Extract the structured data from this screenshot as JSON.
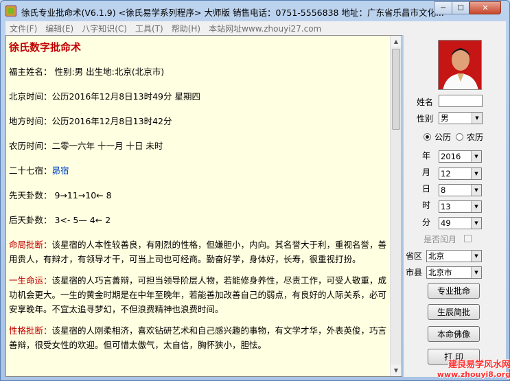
{
  "window": {
    "title": "徐氏专业批命术(V6.1.9) <徐氏易学系列程序> 大师版  销售电话：0751-5556838  地址：广东省乐昌市文化...",
    "controls": [
      "─",
      "☐",
      "✕"
    ]
  },
  "menu": [
    "文件(F)",
    "编辑(E)",
    "八字知识(C)",
    "工具(T)",
    "帮助(H)",
    "本站网址www.zhouyi27.com"
  ],
  "doc": {
    "title": "徐氏数字批命术",
    "lines": [
      "福主姓名：  性别:男   出生地:北京(北京市)",
      "北京时间：公历2016年12月8日13时49分 星期四",
      "地方时间：公历2016年12月8日13时42分",
      "农历时间：二零一六年 十一月 十日 未时"
    ],
    "xiu_label": "二十七宿：",
    "xiu_value": "昴宿",
    "xiantian": "先天卦数： 9→11→10← 8",
    "houtian": "后天卦数： 3<- 5— 4← 2",
    "paras": [
      {
        "label": "命局批断：",
        "text": "该星宿的人本性较善良，有刚烈的性格，但嫌胆小，内向。其名誉大于利，重视名誉，善用贵人，有辩才，有领导才干，可当上司也可经商。勤奋好学，身体好，长寿，很重视打扮。"
      },
      {
        "label": "一生命运：",
        "text": "该星宿的人巧言善辩，可担当领导阶层人物，若能修身养性，尽责工作，可受人敬重，成功机会更大。一生的黄金时期是在中年至晚年，若能善加改善自己的弱点，有良好的人际关系，必可安享晚年。不宜太追寻梦幻，不但浪费精神也浪费时间。"
      },
      {
        "label": "性格批断：",
        "text": "该星宿的人刚柔相济，喜欢钻研艺术和自己感兴趣的事物，有文学才华，外表英俊，巧言善辩，很受女性的欢迎。但可惜太傲气，太自信，胸怀狭小，胆怯。"
      }
    ]
  },
  "side": {
    "name_label": "姓名",
    "name_value": "",
    "gender_label": "性别",
    "gender_value": "男",
    "calendar": {
      "solar": "公历",
      "lunar": "农历",
      "selected": "solar"
    },
    "year_label": "年",
    "year_value": "2016",
    "month_label": "月",
    "month_value": "12",
    "day_label": "日",
    "day_value": "8",
    "hour_label": "时",
    "hour_value": "13",
    "minute_label": "分",
    "minute_value": "49",
    "leap_label": "是否闰月",
    "province_label": "省区",
    "province_value": "北京",
    "city_label": "市县",
    "city_value": "北京市",
    "buttons": [
      "专业批命",
      "生辰简批",
      "本命佛像",
      "打 印"
    ]
  },
  "watermark": {
    "line1": "建良易学风水网",
    "line2": "www.zhouyi8.org"
  },
  "colors": {
    "doc_bg": "#ffffe1",
    "title_red": "#c00000",
    "link_blue": "#0044cc"
  }
}
